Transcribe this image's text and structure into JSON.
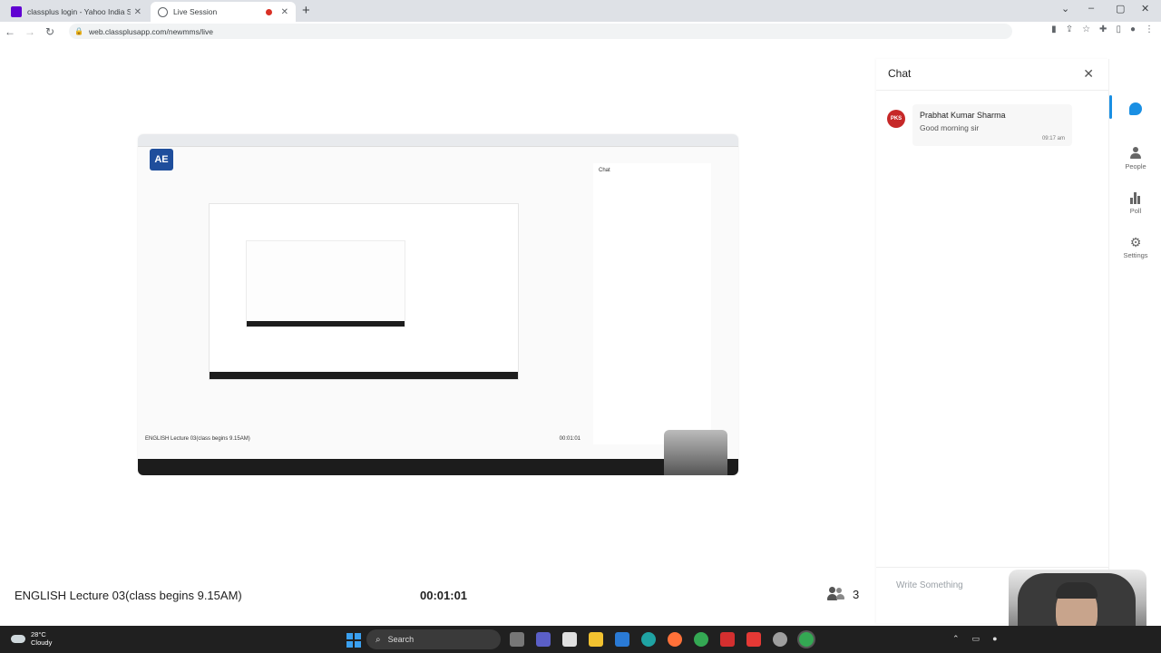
{
  "browser": {
    "tabs": [
      {
        "label": "classplus login - Yahoo India Sea",
        "active": false
      },
      {
        "label": "Live Session",
        "active": true
      }
    ],
    "url": "web.classplusapp.com/newmms/live",
    "icons": [
      "back-icon",
      "forward-icon",
      "reload-icon",
      "lock-icon",
      "camera-icon",
      "share-icon",
      "star-icon",
      "extensions-icon",
      "sidebar-icon",
      "profile-icon",
      "menu-icon"
    ]
  },
  "session": {
    "title": "ENGLISH Lecture 03(class begins 9.15AM)",
    "timer": "00:01:01",
    "participants": "3"
  },
  "shared_screen": {
    "logo": "AE",
    "chat_title": "Chat"
  },
  "chat": {
    "title": "Chat",
    "messages": [
      {
        "initials": "PKS",
        "name": "Prabhat Kumar Sharma",
        "text": "Good morning sir",
        "time": "09:17 am"
      }
    ],
    "input_placeholder": "Write Something"
  },
  "rail": {
    "items": [
      {
        "label": "",
        "icon": "chat-icon",
        "active": true
      },
      {
        "label": "People",
        "icon": "people-icon"
      },
      {
        "label": "Poll",
        "icon": "poll-icon"
      },
      {
        "label": "Settings",
        "icon": "settings-icon"
      }
    ]
  },
  "taskbar": {
    "weather_temp": "28°C",
    "weather_desc": "Cloudy",
    "search_label": "Search"
  },
  "colors": {
    "accent": "#1a8fe3",
    "avatar": "#c62828",
    "taskbar": "#202020"
  }
}
